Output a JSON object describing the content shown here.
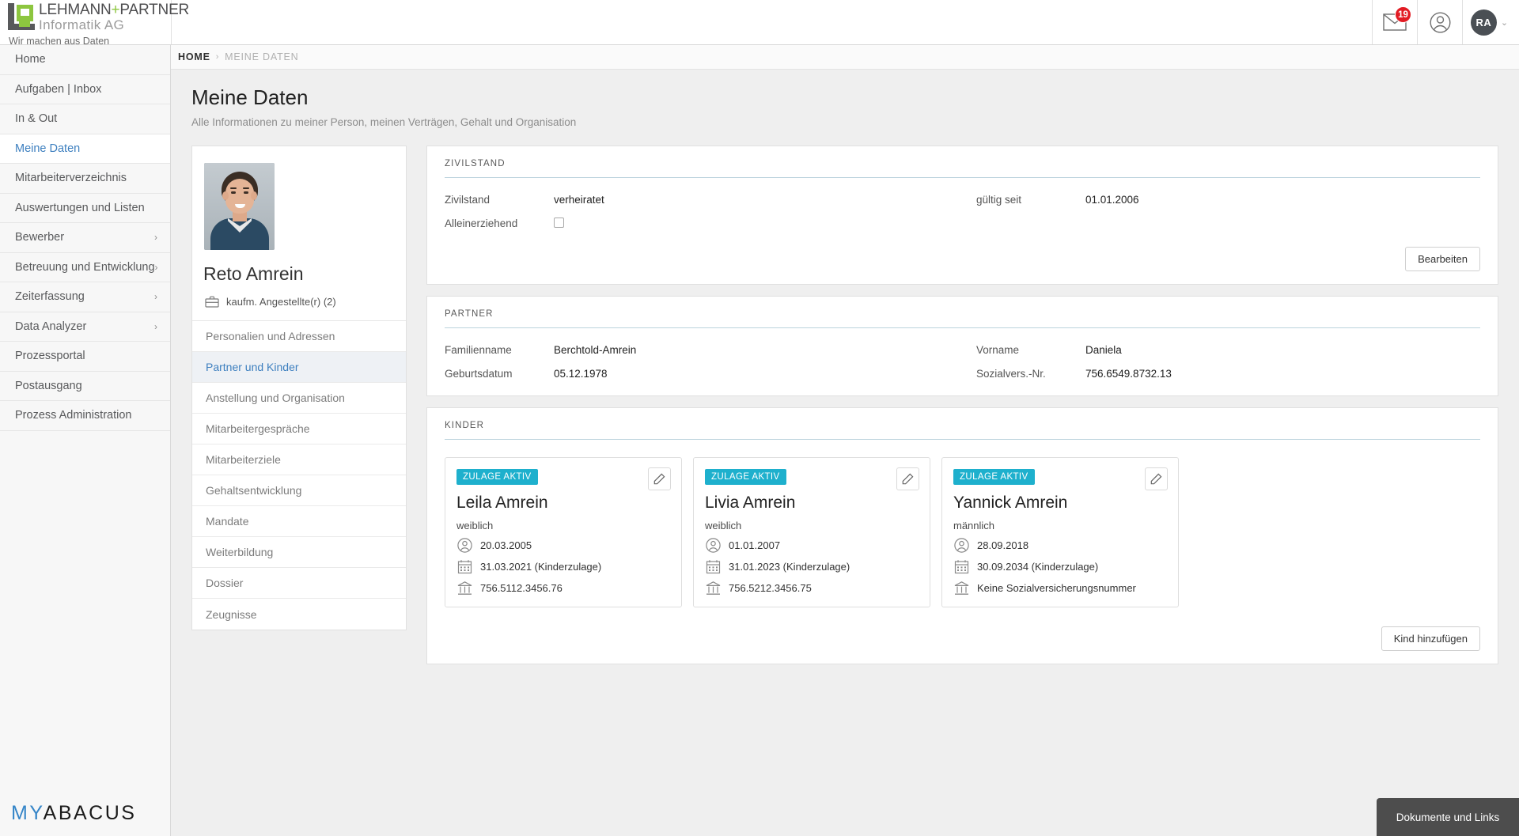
{
  "brand": {
    "line1_a": "LEHMANN",
    "line1_plus": "+",
    "line1_b": "PARTNER",
    "line2": "Informatik AG",
    "tagline": "Wir machen aus Daten Informationen"
  },
  "header": {
    "mail_badge": "19",
    "avatar_initials": "RA",
    "caret": "⌄"
  },
  "breadcrumb": {
    "home": "HOME",
    "separator": "›",
    "current": "MEINE DATEN"
  },
  "sidebar": {
    "items": [
      {
        "label": "Home",
        "active": false,
        "expandable": false
      },
      {
        "label": "Aufgaben | Inbox",
        "active": false,
        "expandable": false
      },
      {
        "label": "In & Out",
        "active": false,
        "expandable": false
      },
      {
        "label": "Meine Daten",
        "active": true,
        "expandable": false
      },
      {
        "label": "Mitarbeiterverzeichnis",
        "active": false,
        "expandable": false
      },
      {
        "label": "Auswertungen und Listen",
        "active": false,
        "expandable": false
      },
      {
        "label": "Bewerber",
        "active": false,
        "expandable": true
      },
      {
        "label": "Betreuung und Entwicklung",
        "active": false,
        "expandable": true
      },
      {
        "label": "Zeiterfassung",
        "active": false,
        "expandable": true
      },
      {
        "label": "Data Analyzer",
        "active": false,
        "expandable": true
      },
      {
        "label": "Prozessportal",
        "active": false,
        "expandable": false
      },
      {
        "label": "Postausgang",
        "active": false,
        "expandable": false
      },
      {
        "label": "Prozess Administration",
        "active": false,
        "expandable": false
      }
    ],
    "footer_logo_my": "MY",
    "footer_logo_abacus": "ABACUS"
  },
  "page": {
    "title": "Meine Daten",
    "subtitle": "Alle Informationen zu meiner Person, meinen Verträgen, Gehalt und Organisation"
  },
  "profile": {
    "name": "Reto Amrein",
    "role": "kaufm. Angestellte(r) (2)",
    "tabs": [
      {
        "label": "Personalien und Adressen",
        "active": false
      },
      {
        "label": "Partner und Kinder",
        "active": true
      },
      {
        "label": "Anstellung und Organisation",
        "active": false
      },
      {
        "label": "Mitarbeitergespräche",
        "active": false
      },
      {
        "label": "Mitarbeiterziele",
        "active": false
      },
      {
        "label": "Gehaltsentwicklung",
        "active": false
      },
      {
        "label": "Mandate",
        "active": false
      },
      {
        "label": "Weiterbildung",
        "active": false
      },
      {
        "label": "Dossier",
        "active": false
      },
      {
        "label": "Zeugnisse",
        "active": false
      }
    ]
  },
  "zivilstand": {
    "title": "ZIVILSTAND",
    "label_zivilstand": "Zivilstand",
    "value_zivilstand": "verheiratet",
    "label_alleinerziehend": "Alleinerziehend",
    "label_gueltig_seit": "gültig seit",
    "value_gueltig_seit": "01.01.2006",
    "edit_button": "Bearbeiten"
  },
  "partner": {
    "title": "PARTNER",
    "label_familienname": "Familienname",
    "value_familienname": "Berchtold-Amrein",
    "label_geburtsdatum": "Geburtsdatum",
    "value_geburtsdatum": "05.12.1978",
    "label_vorname": "Vorname",
    "value_vorname": "Daniela",
    "label_sozialvers": "Sozialvers.-Nr.",
    "value_sozialvers": "756.6549.8732.13"
  },
  "kinder": {
    "title": "KINDER",
    "add_button": "Kind hinzufügen",
    "cards": [
      {
        "badge": "ZULAGE AKTIV",
        "name": "Leila Amrein",
        "gender": "weiblich",
        "birthdate": "20.03.2005",
        "allowance": "31.03.2021 (Kinderzulage)",
        "ssn": "756.5112.3456.76"
      },
      {
        "badge": "ZULAGE AKTIV",
        "name": "Livia Amrein",
        "gender": "weiblich",
        "birthdate": "01.01.2007",
        "allowance": "31.01.2023 (Kinderzulage)",
        "ssn": "756.5212.3456.75"
      },
      {
        "badge": "ZULAGE AKTIV",
        "name": "Yannick Amrein",
        "gender": "männlich",
        "birthdate": "28.09.2018",
        "allowance": "30.09.2034 (Kinderzulage)",
        "ssn": "Keine Sozialversicherungsnummer"
      }
    ]
  },
  "footer": {
    "docs_tab": "Dokumente und Links"
  },
  "colors": {
    "accent_blue": "#3d7fbf",
    "badge_red": "#e21b23",
    "badge_cyan": "#1eb0cd",
    "brand_green": "#8dc63f",
    "panel_rule": "#bcd3dd"
  }
}
